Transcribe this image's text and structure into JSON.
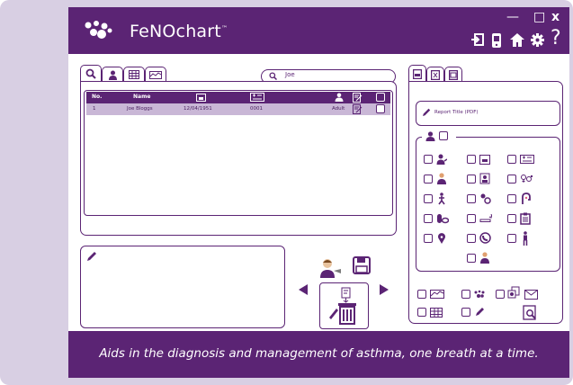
{
  "app": {
    "logo_text": "FeNOchart",
    "trademark": "™",
    "tagline": "Aids in the diagnosis and management of asthma, one breath at a time."
  },
  "window_controls": {
    "minimize": "—",
    "maximize": "□",
    "close": "x"
  },
  "header_icons": [
    "logout-icon",
    "device-icon",
    "home-icon",
    "settings-icon",
    "help-icon"
  ],
  "help_label": "?",
  "search": {
    "value": "Joe",
    "placeholder": ""
  },
  "patient_table": {
    "headers": {
      "no": "No.",
      "name": "Name"
    },
    "rows": [
      {
        "no": "1",
        "name": "Joe Bloggs",
        "dob": "12/04/1951",
        "id": "0001",
        "category": "Adult"
      }
    ]
  },
  "report": {
    "title_placeholder": "Report Title (PDF)"
  },
  "colors": {
    "brand": "#5b2474",
    "row_highlight": "#c9b7d6",
    "background": "#d8cfe3"
  },
  "report_options": [
    "patient-icon",
    "calendar-icon",
    "id-card-icon",
    "doctor-icon",
    "smoker-icon",
    "gender-icon",
    "walking-icon",
    "pets-icon",
    "nose-icon",
    "pills-icon",
    "cigarette-icon",
    "clipboard-icon",
    "location-icon",
    "phone-icon",
    "person-icon",
    "clinician-icon"
  ],
  "export_options": [
    "graph-icon",
    "logo-icon",
    "transfer-icon",
    "email-icon",
    "table-icon",
    "pen-icon",
    "preview-icon"
  ]
}
